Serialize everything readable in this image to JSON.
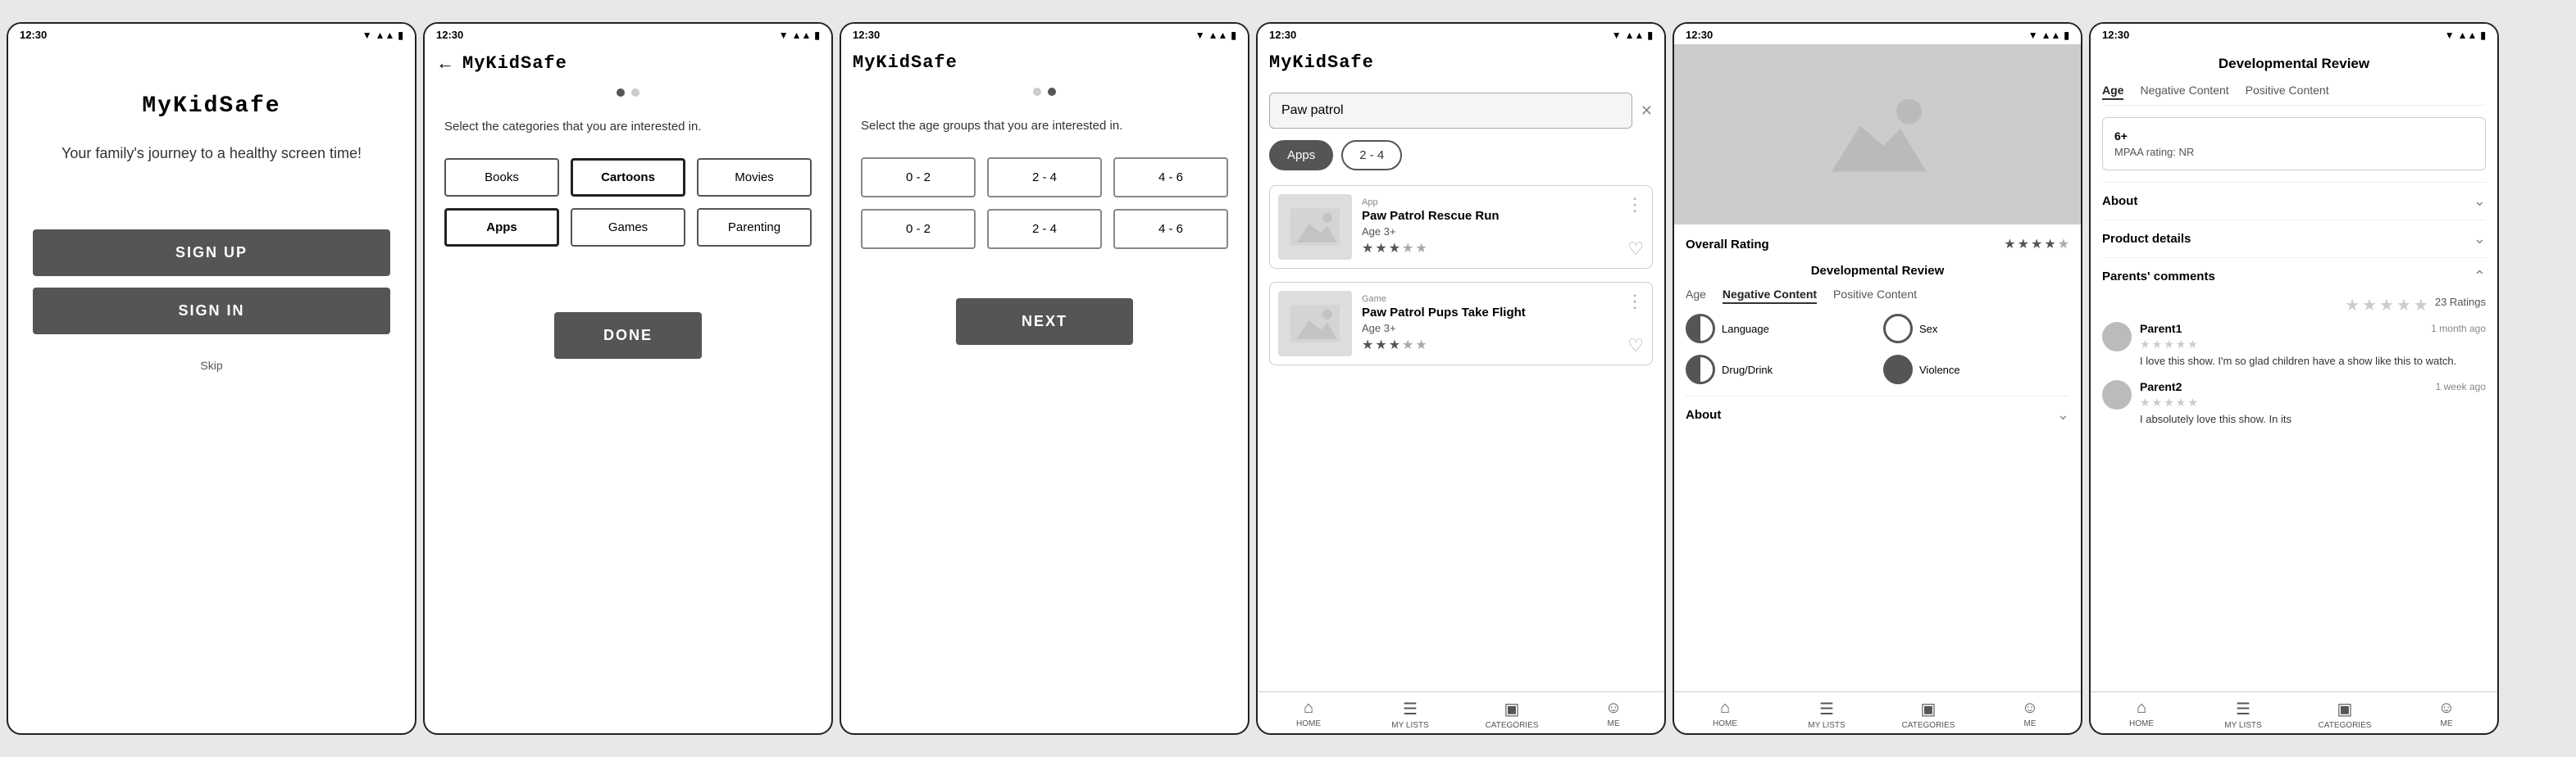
{
  "screen1": {
    "status_time": "12:30",
    "logo": "MyKidSafe",
    "tagline": "Your family's journey to a healthy screen time!",
    "signup_label": "SIGN UP",
    "signin_label": "SIGN IN",
    "skip_label": "Skip"
  },
  "screen2": {
    "status_time": "12:30",
    "title": "MyKidSafe",
    "subtitle": "Select the categories that you are interested in.",
    "categories": [
      "Books",
      "Cartoons",
      "Movies",
      "Apps",
      "Games",
      "Parenting"
    ],
    "selected": [
      1
    ],
    "done_label": "DONE"
  },
  "screen3": {
    "status_time": "12:30",
    "title": "MyKidSafe",
    "subtitle": "Select the age groups that you are interested in.",
    "age_groups": [
      "0 - 2",
      "2 - 4",
      "4 - 6",
      "0 - 2",
      "2 - 4",
      "4 - 6"
    ],
    "next_label": "NEXT"
  },
  "screen4": {
    "status_time": "12:30",
    "title": "MyKidSafe",
    "search_value": "Paw patrol",
    "filter1": "Apps",
    "filter2": "2 - 4",
    "results": [
      {
        "type": "App",
        "name": "Paw Patrol Rescue Run",
        "age": "Age 3+",
        "stars": 3
      },
      {
        "type": "Game",
        "name": "Paw Patrol Pups Take Flight",
        "age": "Age 3+",
        "stars": 3
      }
    ],
    "nav": [
      "HOME",
      "MY LISTS",
      "CATEGORIES",
      "ME"
    ]
  },
  "screen5": {
    "status_time": "12:30",
    "overall_rating_label": "Overall Rating",
    "overall_stars": 4,
    "dev_review_title": "Developmental Review",
    "tabs": [
      "Age",
      "Negative Content",
      "Positive Content"
    ],
    "active_tab": "Negative Content",
    "metrics": [
      "Language",
      "Sex",
      "Drug/Drink",
      "Violence"
    ],
    "about_label": "About",
    "nav": [
      "HOME",
      "MY LISTS",
      "CATEGORIES",
      "ME"
    ]
  },
  "screen6": {
    "status_time": "12:30",
    "dev_review_header": "Developmental Review",
    "tabs": [
      "Age",
      "Negative Content",
      "Positive Content"
    ],
    "active_tab": "Age",
    "age_value": "6+",
    "mpaa_label": "MPAA rating: NR",
    "sections": [
      "About",
      "Product details",
      "Parents' comments"
    ],
    "open_section": "Parents' comments",
    "ratings_count": "23 Ratings",
    "comments": [
      {
        "user": "Parent1",
        "time": "1 month ago",
        "stars": 0,
        "text": "I love this show. I'm so glad children have a show like this to watch."
      },
      {
        "user": "Parent2",
        "time": "1 week ago",
        "stars": 0,
        "text": "I absolutely love this show. In its"
      }
    ],
    "nav": [
      "HOME",
      "MY LISTS",
      "CATEGORIES",
      "ME"
    ]
  }
}
